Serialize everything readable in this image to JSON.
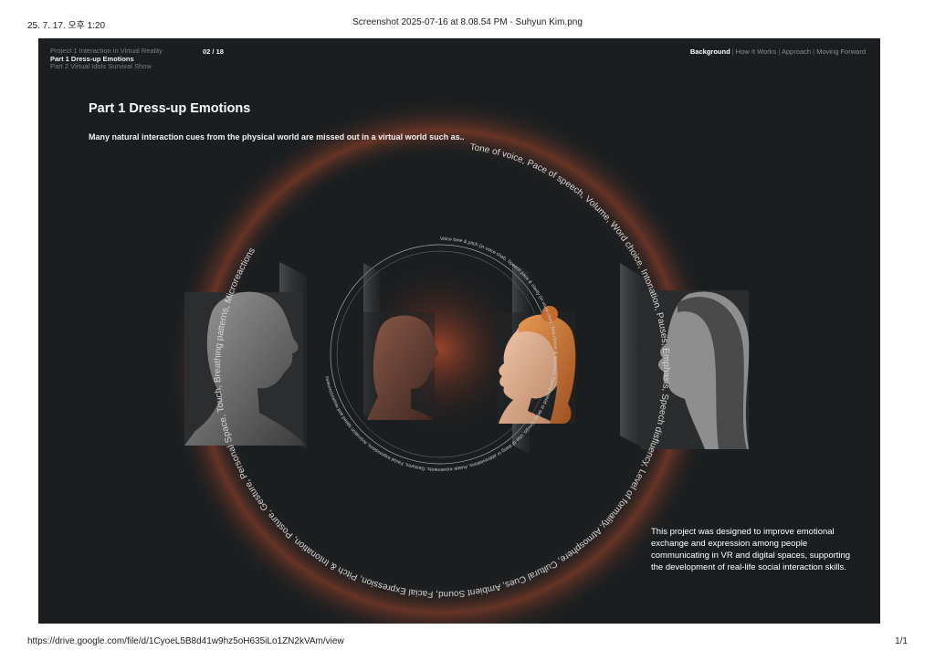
{
  "print": {
    "date": "25. 7. 17. 오후 1:20",
    "title": "Screenshot 2025-07-16 at 8.08.54 PM - Suhyun Kim.png",
    "url": "https://drive.google.com/file/d/1CyoeL5B8d41w9hz5oH635iLo1ZN2kVAm/view",
    "page": "1/1"
  },
  "nav": {
    "projects": [
      {
        "label": "Project 1 Interaction in Virtual Reality",
        "active": false
      },
      {
        "label": "Part 1 Dress-up Emotions",
        "active": true
      },
      {
        "label": "Part 2 Virtual Idols Survival Show",
        "active": false
      }
    ],
    "page_number": "02 / 18",
    "sections": [
      {
        "label": "Background",
        "active": true
      },
      {
        "label": "How It Works",
        "active": false
      },
      {
        "label": "Approach",
        "active": false
      },
      {
        "label": "Moving Forward",
        "active": false
      }
    ],
    "separator": "|"
  },
  "slide": {
    "heading": "Part 1  Dress-up Emotions",
    "subheading": "Many natural interaction cues from the physical world are missed out in a virtual world such as..",
    "outer_ring_text": "Tone of voice, Pace of speech, Volume, Word choice, Intonation, Pauses, Emphasis, Speech disfluency, Level of formality, Atmosphere, Cultural Cues, Ambient Sound, Facial Expression, Pitch & Intonation, Posture, Gesture, Personal Space, Touch, Breathing patterns, Microreactions",
    "inner_ring_text": "Voice tone & pitch (in voice chat), Speech pace & clarity (in voice chat), Text choice & structure, Typing speed or delay, Emojis, Use of slang or abbreviations, Avatar movements, Gestures, Facial expressions, Animation speed and responsiveness",
    "description": "This project was designed to improve emotional exchange and expression among people communicating in VR and digital spaces, supporting the development of real-life social interaction skills."
  },
  "colors": {
    "slide_bg": "#1b1e20",
    "glow": "#b24a2a",
    "ring_text": "#d6d6d6"
  }
}
